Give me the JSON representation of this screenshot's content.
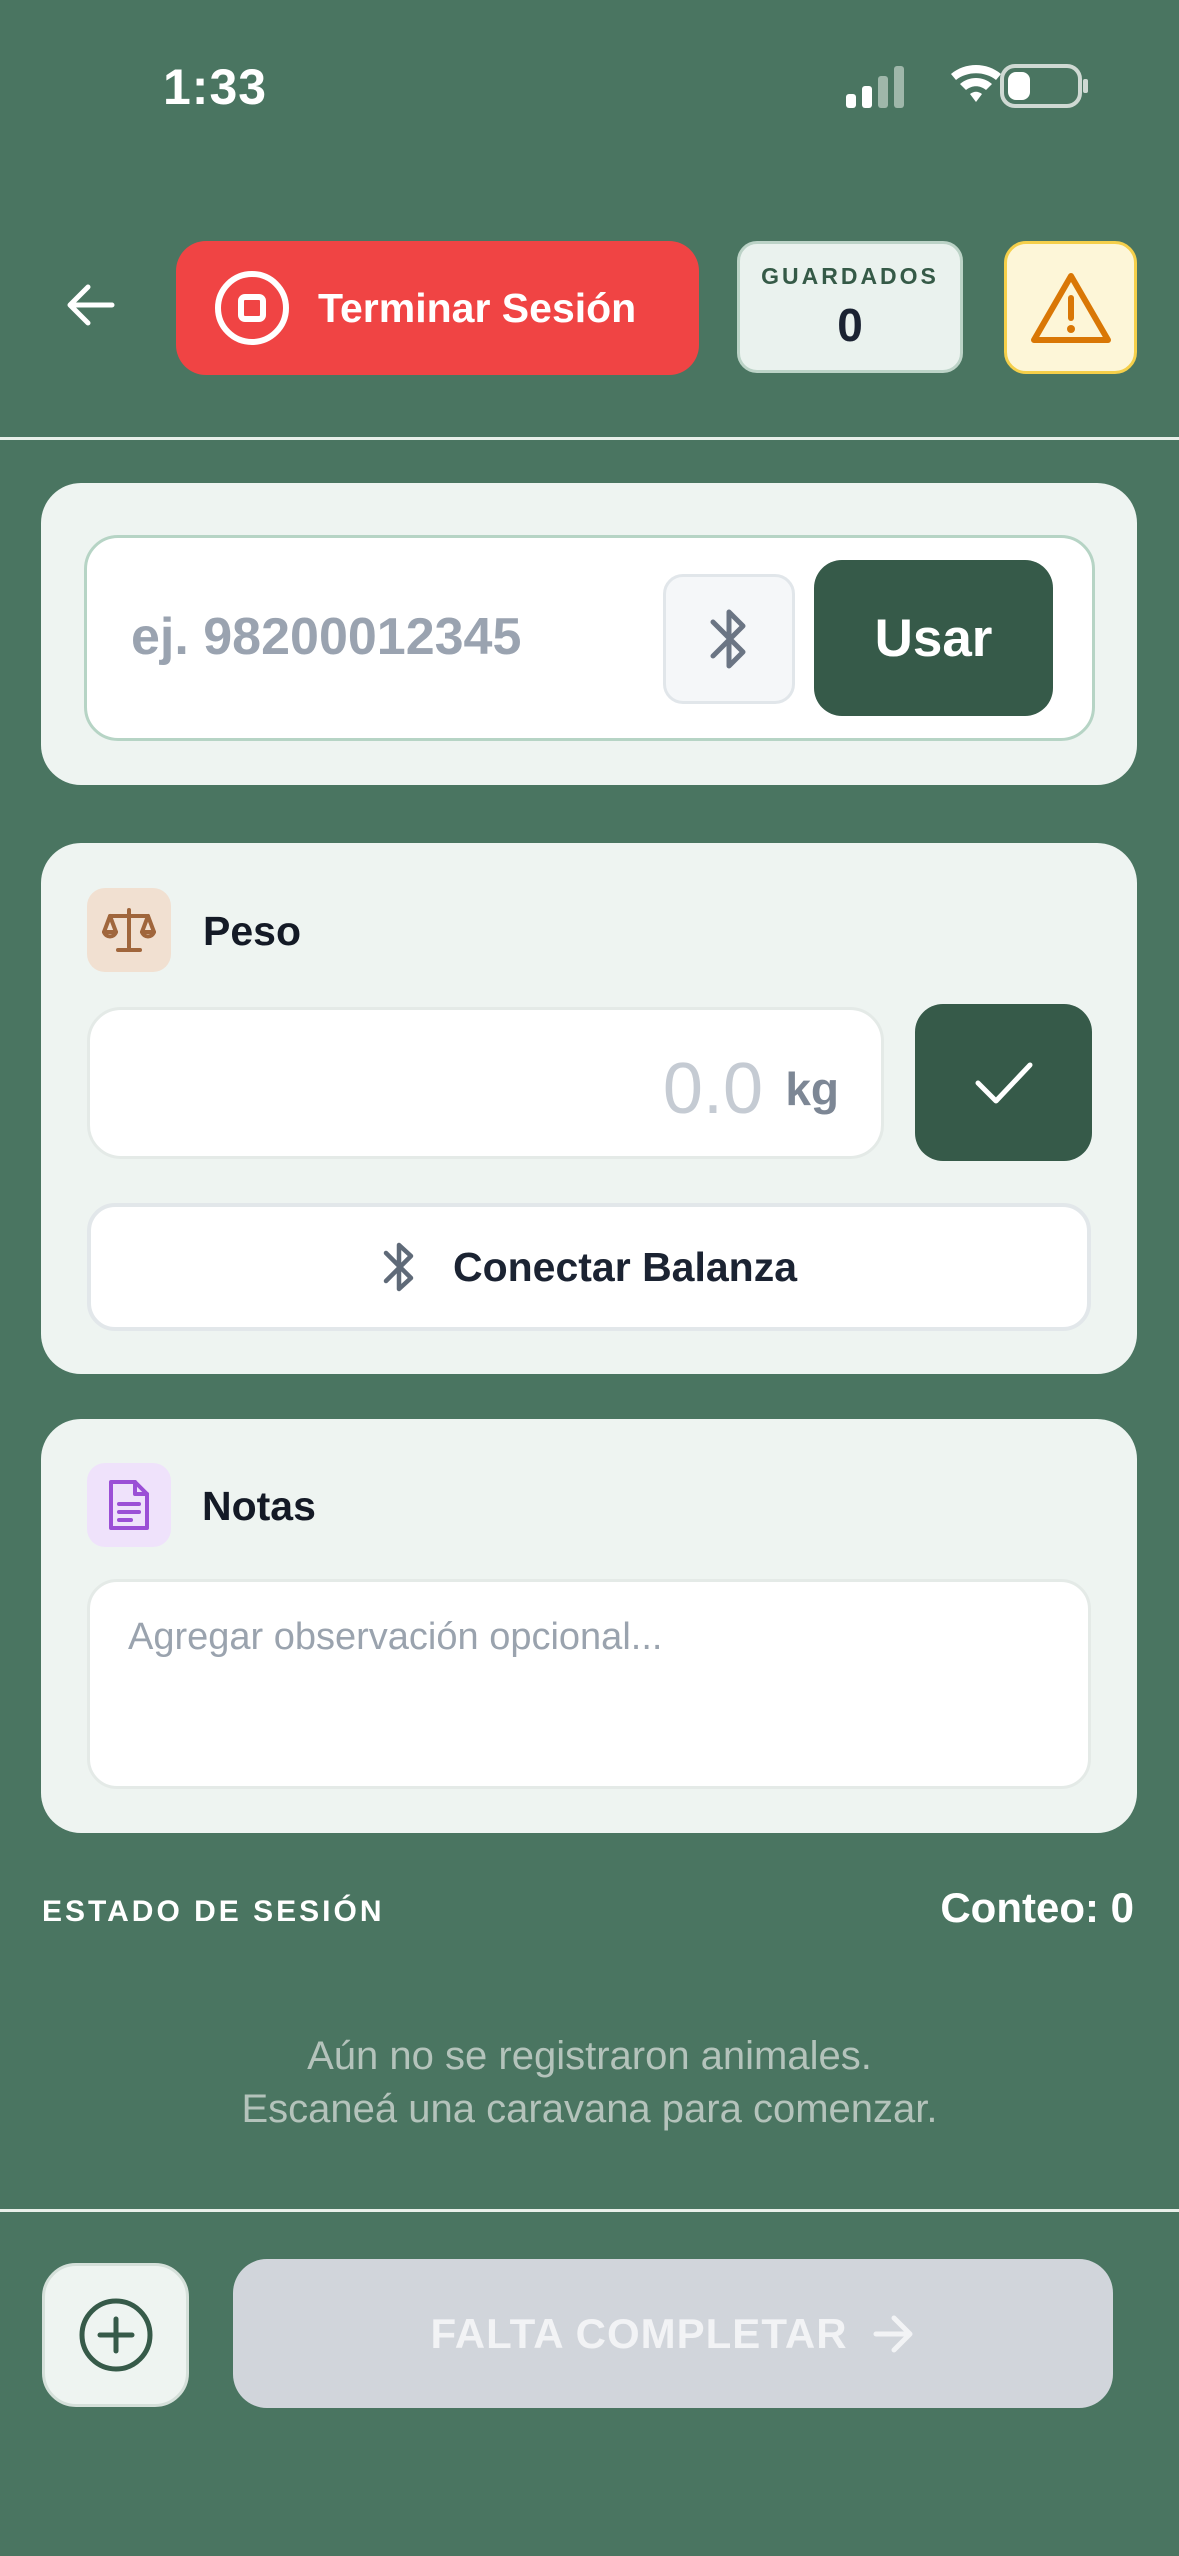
{
  "status_bar": {
    "time": "1:33",
    "icons": [
      "signal-icon",
      "wifi-icon",
      "battery-icon"
    ]
  },
  "header": {
    "end_session_label": "Terminar Sesión",
    "saved": {
      "label": "GUARDADOS",
      "value": "0"
    }
  },
  "tag": {
    "placeholder": "ej. 98200012345",
    "value": "",
    "use_label": "Usar"
  },
  "weight": {
    "title": "Peso",
    "value_placeholder": "0.0",
    "unit": "kg",
    "connect_label": "Conectar Balanza"
  },
  "notes": {
    "title": "Notas",
    "placeholder": "Agregar observación opcional..."
  },
  "session": {
    "state_label": "ESTADO DE SESIÓN",
    "count_label": "Conteo: 0",
    "empty_line1": "Aún no se registraron animales.",
    "empty_line2": "Escaneá una caravana para comenzar."
  },
  "footer": {
    "complete_label": "FALTA COMPLETAR"
  },
  "colors": {
    "background": "#4a7561",
    "danger": "#f04444",
    "primary": "#365a49",
    "warning_bg": "#fdf6d8",
    "warning_icon": "#d97706",
    "disabled": "#d1d5db"
  }
}
